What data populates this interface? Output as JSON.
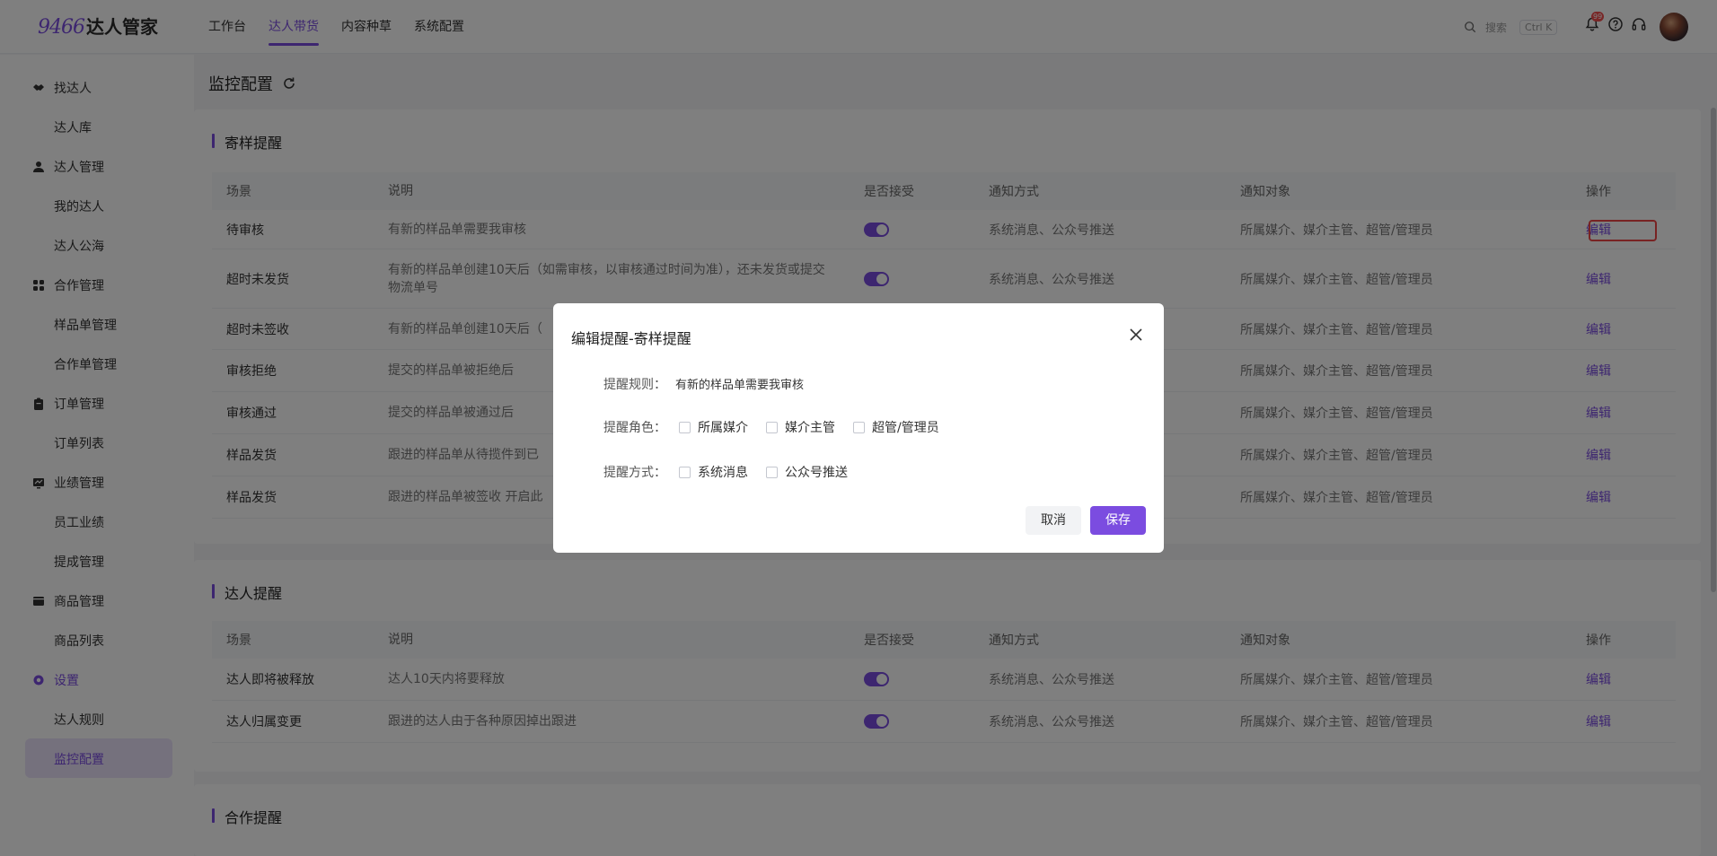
{
  "app": {
    "logo_num": "9466",
    "logo_name": "达人管家"
  },
  "topnav": [
    {
      "label": "工作台"
    },
    {
      "label": "达人带货"
    },
    {
      "label": "内容种草"
    },
    {
      "label": "系统配置"
    }
  ],
  "search": {
    "label": "搜索",
    "shortcut": "Ctrl K"
  },
  "notifications": {
    "count": "99"
  },
  "sidebar": {
    "groups": [
      {
        "label": "找达人",
        "icon": "handshake-icon"
      },
      {
        "label": "达人管理",
        "icon": "user-icon"
      },
      {
        "label": "合作管理",
        "icon": "grid-icon"
      },
      {
        "label": "订单管理",
        "icon": "clipboard-icon"
      },
      {
        "label": "业绩管理",
        "icon": "chart-icon"
      },
      {
        "label": "商品管理",
        "icon": "box-icon"
      },
      {
        "label": "设置",
        "icon": "gear-icon"
      }
    ],
    "items": [
      {
        "label": "达人库"
      },
      {
        "label": "我的达人"
      },
      {
        "label": "达人公海"
      },
      {
        "label": "样品单管理"
      },
      {
        "label": "合作单管理"
      },
      {
        "label": "订单列表"
      },
      {
        "label": "员工业绩"
      },
      {
        "label": "提成管理"
      },
      {
        "label": "商品列表"
      },
      {
        "label": "达人规则"
      },
      {
        "label": "监控配置"
      }
    ]
  },
  "page": {
    "title": "监控配置"
  },
  "columns": {
    "scene": "场景",
    "desc": "说明",
    "accept": "是否接受",
    "method": "通知方式",
    "target": "通知对象",
    "action": "操作"
  },
  "section1": {
    "title": "寄样提醒",
    "rows": [
      {
        "scene": "待审核",
        "desc": "有新的样品单需要我审核",
        "method": "系统消息、公众号推送",
        "target": "所属媒介、媒介主管、超管/管理员",
        "action": "编辑",
        "accept": true
      },
      {
        "scene": "超时未发货",
        "desc": "有新的样品单创建10天后（如需审核，以审核通过时间为准），还未发货或提交物流单号",
        "method": "系统消息、公众号推送",
        "target": "所属媒介、媒介主管、超管/管理员",
        "action": "编辑",
        "accept": true
      },
      {
        "scene": "超时未签收",
        "desc": "有新的样品单创建10天后（",
        "method": "",
        "target": "所属媒介、媒介主管、超管/管理员",
        "action": "编辑",
        "accept": false
      },
      {
        "scene": "审核拒绝",
        "desc": "提交的样品单被拒绝后",
        "method": "",
        "target": "所属媒介、媒介主管、超管/管理员",
        "action": "编辑",
        "accept": false
      },
      {
        "scene": "审核通过",
        "desc": "提交的样品单被通过后",
        "method": "",
        "target": "所属媒介、媒介主管、超管/管理员",
        "action": "编辑",
        "accept": false
      },
      {
        "scene": "样品发货",
        "desc": "跟进的样品单从待揽件到已",
        "method": "",
        "target": "所属媒介、媒介主管、超管/管理员",
        "action": "编辑",
        "accept": false
      },
      {
        "scene": "样品发货",
        "desc": "跟进的样品单被签收 开启此",
        "method": "",
        "target": "所属媒介、媒介主管、超管/管理员",
        "action": "编辑",
        "accept": false
      }
    ]
  },
  "section2": {
    "title": "达人提醒",
    "rows": [
      {
        "scene": "达人即将被释放",
        "desc": "达人10天内将要释放",
        "method": "系统消息、公众号推送",
        "target": "所属媒介、媒介主管、超管/管理员",
        "action": "编辑",
        "accept": true
      },
      {
        "scene": "达人归属变更",
        "desc": "跟进的达人由于各种原因掉出跟进",
        "method": "系统消息、公众号推送",
        "target": "所属媒介、媒介主管、超管/管理员",
        "action": "编辑",
        "accept": true
      }
    ]
  },
  "section3": {
    "title": "合作提醒"
  },
  "modal": {
    "title": "编辑提醒-寄样提醒",
    "rule_label": "提醒规则：",
    "rule_value": "有新的样品单需要我审核",
    "role_label": "提醒角色：",
    "roles": [
      "所属媒介",
      "媒介主管",
      "超管/管理员"
    ],
    "method_label": "提醒方式：",
    "methods": [
      "系统消息",
      "公众号推送"
    ],
    "cancel": "取消",
    "save": "保存"
  },
  "colors": {
    "accent": "#7b4ce0",
    "highlight": "#f04646",
    "overlay": "rgba(0,0,0,0.5)"
  }
}
